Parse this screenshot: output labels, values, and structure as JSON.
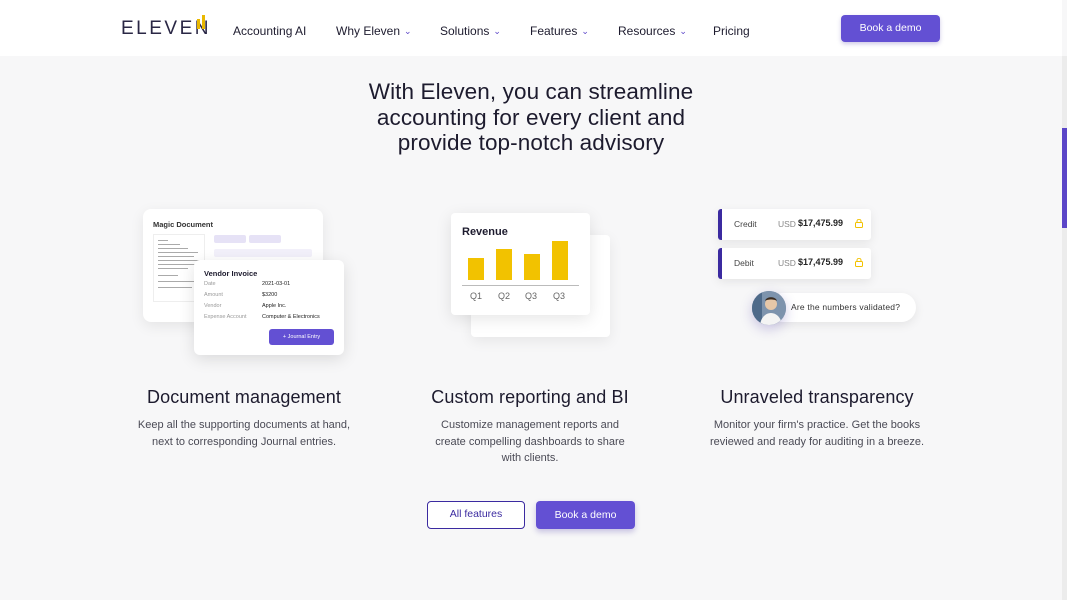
{
  "nav": {
    "logo": "ELEVEN",
    "items": [
      {
        "label": "Accounting AI",
        "dropdown": false
      },
      {
        "label": "Why Eleven",
        "dropdown": true
      },
      {
        "label": "Solutions",
        "dropdown": true
      },
      {
        "label": "Features",
        "dropdown": true
      },
      {
        "label": "Resources",
        "dropdown": true
      },
      {
        "label": "Pricing",
        "dropdown": false
      }
    ],
    "cta": "Book a demo"
  },
  "hero": {
    "line1": "With Eleven, you can streamline",
    "line2": "accounting for every client and",
    "line3": "provide top-notch advisory"
  },
  "doc_card": {
    "title": "Magic Document",
    "invoice_title": "Vendor Invoice",
    "fields": [
      {
        "key": "Date",
        "value": "2021-03-01"
      },
      {
        "key": "Amount",
        "value": "$3200"
      },
      {
        "key": "Vendor",
        "value": "Apple Inc."
      },
      {
        "key": "Expense Account",
        "value": "Computer & Electronics"
      }
    ],
    "button": "+ Journal Entry"
  },
  "revenue_card": {
    "title": "Revenue",
    "ticks": [
      "Q1",
      "Q2",
      "Q3",
      "Q3"
    ]
  },
  "chart_data": {
    "type": "bar",
    "categories": [
      "Q1",
      "Q2",
      "Q3",
      "Q3"
    ],
    "values": [
      2,
      2.8,
      2.4,
      3.5
    ],
    "title": "Revenue",
    "xlabel": "",
    "ylabel": "",
    "ylim": [
      0,
      4
    ]
  },
  "transparency_card": {
    "rows": [
      {
        "label": "Credit",
        "currency": "USD",
        "amount": "$17,475.99"
      },
      {
        "label": "Debit",
        "currency": "USD",
        "amount": "$17,475.99"
      }
    ],
    "question": "Are the numbers validated?"
  },
  "features": [
    {
      "title": "Document management",
      "line1": "Keep all the supporting documents at hand,",
      "line2": "next to corresponding Journal entries.",
      "line3": ""
    },
    {
      "title": "Custom reporting and BI",
      "line1": "Customize management reports and",
      "line2": "create compelling dashboards to share",
      "line3": "with clients."
    },
    {
      "title": "Unraveled transparency",
      "line1": "Monitor your firm's practice. Get the books",
      "line2": "reviewed and ready for auditing in a breeze.",
      "line3": ""
    }
  ],
  "actions": {
    "all_features": "All features",
    "book_demo": "Book a demo"
  },
  "colors": {
    "accent": "#6350d3",
    "accent_dark": "#3b2aa0",
    "bar": "#f2c200",
    "logo_mark": "#e9b800"
  }
}
